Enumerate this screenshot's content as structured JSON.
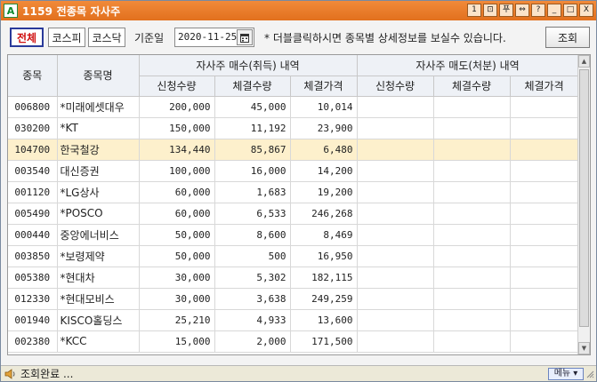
{
  "window": {
    "title": "1159 전종목 자사주",
    "title_buttons": [
      "1",
      "⊡",
      "푸",
      "⇔",
      "?",
      "_",
      "□",
      "X"
    ]
  },
  "toolbar": {
    "tabs": [
      {
        "label": "전체",
        "active": true
      },
      {
        "label": "코스피",
        "active": false
      },
      {
        "label": "코스닥",
        "active": false
      }
    ],
    "date_label": "기준일",
    "date_value": "2020-11-25",
    "hint": "* 더블클릭하시면 종목별 상세정보를 보실수 있습니다.",
    "search_label": "조회"
  },
  "grid": {
    "headers": {
      "code": "종목",
      "name": "종목명",
      "buy_group": "자사주 매수(취득) 내역",
      "sell_group": "자사주 매도(처분) 내역",
      "buy_cols": [
        "신청수량",
        "체결수량",
        "체결가격"
      ],
      "sell_cols": [
        "신청수량",
        "체결수량",
        "체결가격"
      ]
    },
    "rows": [
      {
        "code": "006800",
        "name": "*미래에셋대우",
        "req": "200,000",
        "qty": "45,000",
        "price": "10,014"
      },
      {
        "code": "030200",
        "name": "*KT",
        "req": "150,000",
        "qty": "11,192",
        "price": "23,900"
      },
      {
        "code": "104700",
        "name": " 한국철강",
        "req": "134,440",
        "qty": "85,867",
        "price": "6,480",
        "selected": true
      },
      {
        "code": "003540",
        "name": " 대신증권",
        "req": "100,000",
        "qty": "16,000",
        "price": "14,200"
      },
      {
        "code": "001120",
        "name": "*LG상사",
        "req": "60,000",
        "qty": "1,683",
        "price": "19,200"
      },
      {
        "code": "005490",
        "name": "*POSCO",
        "req": "60,000",
        "qty": "6,533",
        "price": "246,268"
      },
      {
        "code": "000440",
        "name": " 중앙에너비스",
        "req": "50,000",
        "qty": "8,600",
        "price": "8,469"
      },
      {
        "code": "003850",
        "name": "*보령제약",
        "req": "50,000",
        "qty": "500",
        "price": "16,950"
      },
      {
        "code": "005380",
        "name": "*현대차",
        "req": "30,000",
        "qty": "5,302",
        "price": "182,115"
      },
      {
        "code": "012330",
        "name": "*현대모비스",
        "req": "30,000",
        "qty": "3,638",
        "price": "249,259"
      },
      {
        "code": "001940",
        "name": " KISCO홀딩스",
        "req": "25,210",
        "qty": "4,933",
        "price": "13,600"
      },
      {
        "code": "002380",
        "name": "*KCC",
        "req": "15,000",
        "qty": "2,000",
        "price": "171,500"
      }
    ]
  },
  "status": {
    "text": "조회완료 ...",
    "menu_label": "메뉴 ▾"
  },
  "colors": {
    "title_bar": "#e2701d",
    "selected_row": "#fdf0cc",
    "active_tab_text": "#d01010"
  }
}
